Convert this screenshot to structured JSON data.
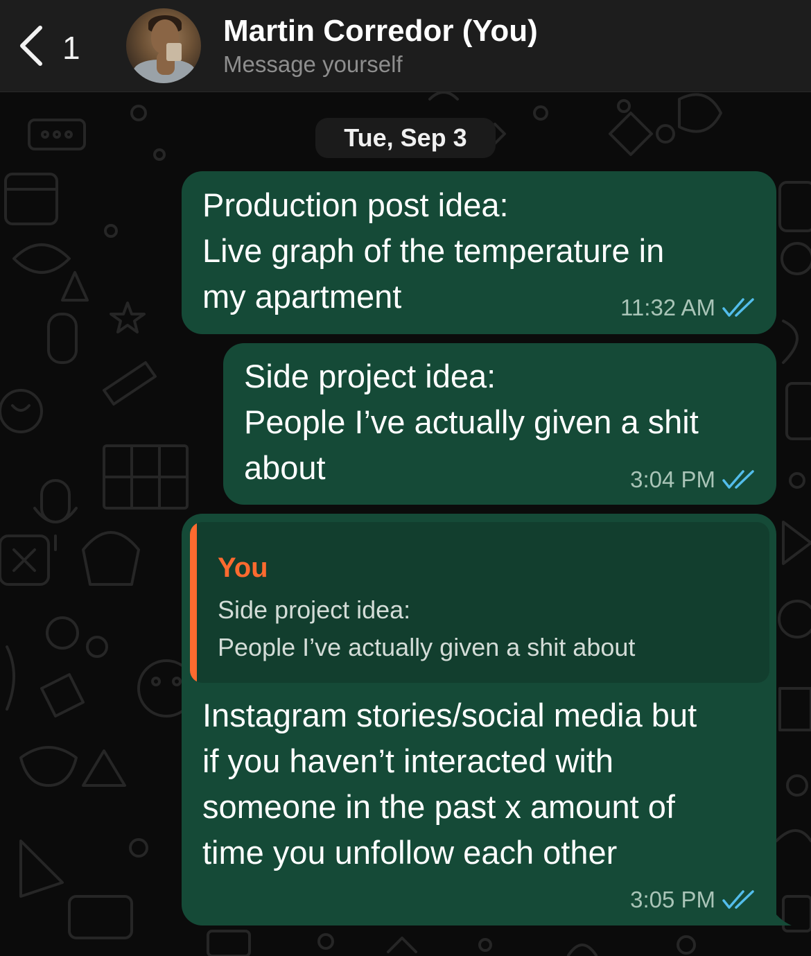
{
  "header": {
    "back_count": "1",
    "contact_name": "Martin Corredor (You)",
    "subtitle": "Message yourself"
  },
  "date_divider": "Tue, Sep 3",
  "messages": [
    {
      "lines": [
        "Production post idea:",
        "Live graph of the temperature in",
        "my apartment"
      ],
      "time": "11:32 AM",
      "status": "read"
    },
    {
      "lines": [
        "Side project idea:",
        "People I’ve actually given a shit",
        "about"
      ],
      "time": "3:04 PM",
      "status": "read"
    },
    {
      "reply_to": {
        "author": "You",
        "lines": [
          "Side project idea:",
          "People I’ve actually given a shit about"
        ]
      },
      "lines": [
        "Instagram stories/social media but",
        "if you haven’t interacted with",
        "someone in the past x amount of",
        "time you unfollow each other"
      ],
      "time": "3:05 PM",
      "status": "read"
    }
  ],
  "colors": {
    "header_bg": "#1d1d1d",
    "bubble_out": "#154a37",
    "quote_bg": "#123e2e",
    "quote_accent": "#ff6a2f",
    "read_ticks": "#53bdeb",
    "chat_bg": "#0b0b0b"
  },
  "icons": {
    "back": "chevron-left-icon",
    "read_status": "double-check-icon"
  }
}
